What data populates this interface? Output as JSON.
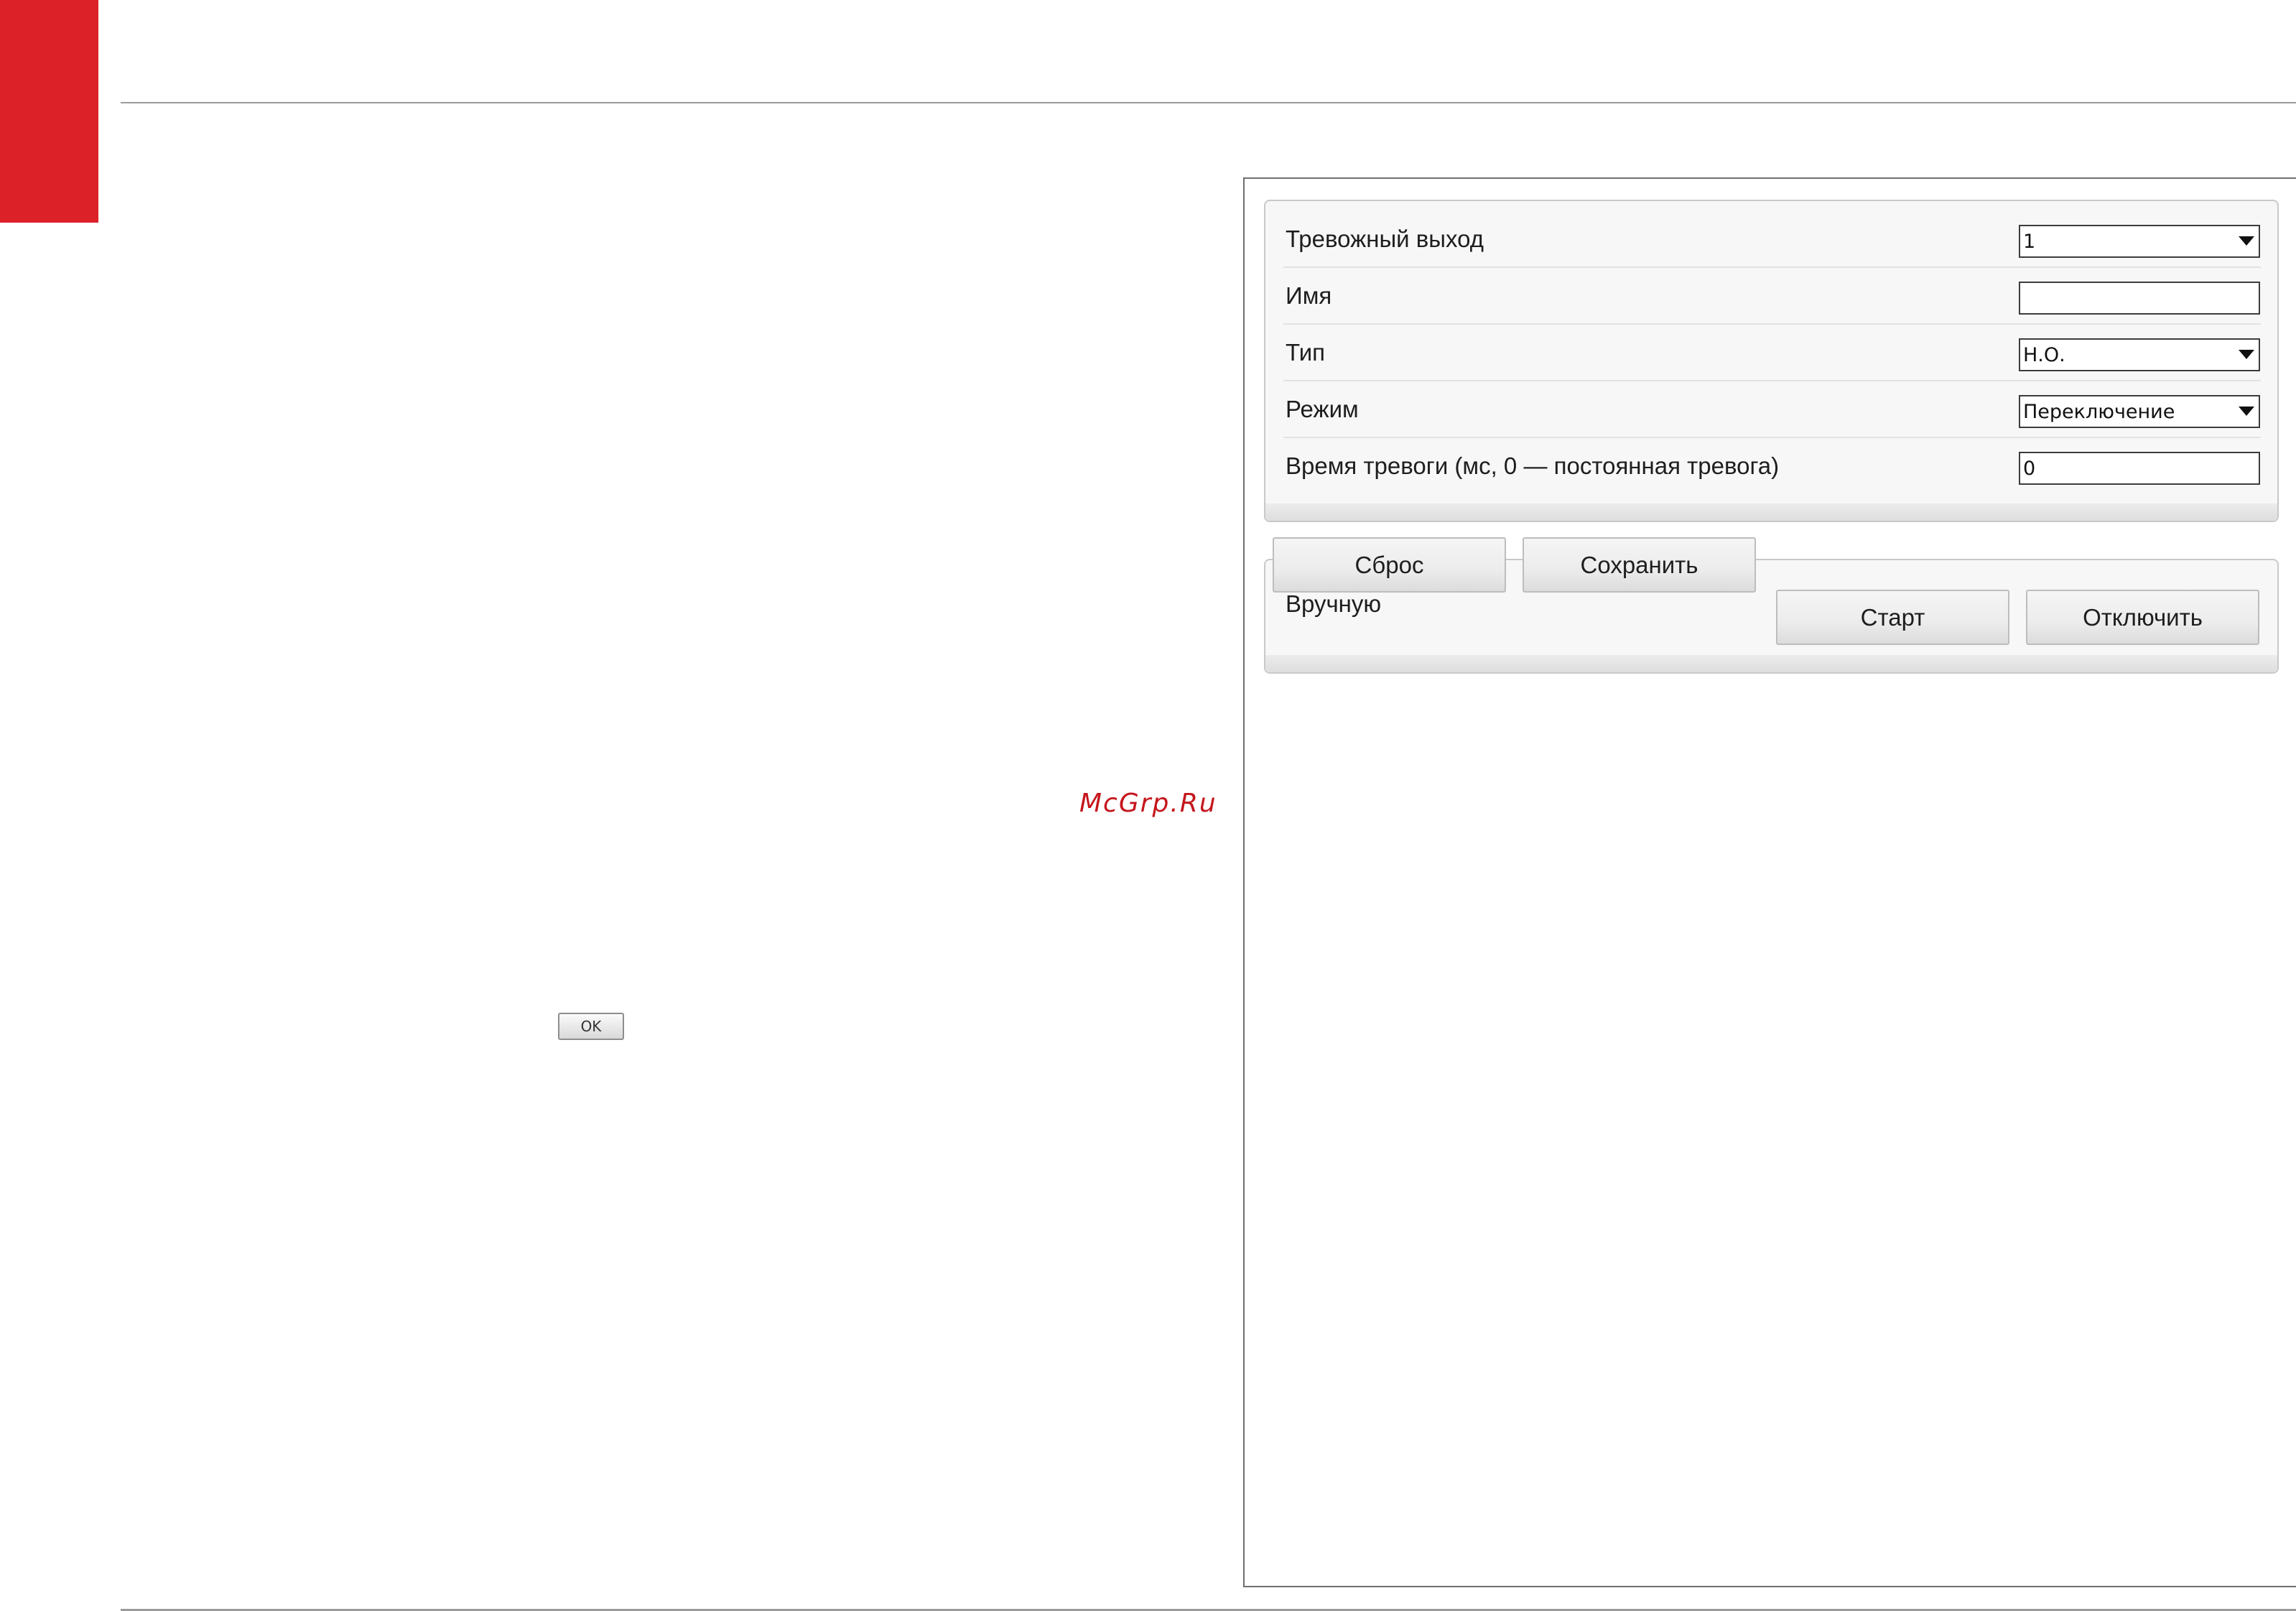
{
  "watermark": "McGrp.Ru",
  "ok_button": "OK",
  "alarm_output": {
    "rows": [
      {
        "label": "Тревожный выход",
        "kind": "select",
        "value": "1"
      },
      {
        "label": "Имя",
        "kind": "text",
        "value": ""
      },
      {
        "label": "Тип",
        "kind": "select",
        "value": "Н.О."
      },
      {
        "label": "Режим",
        "kind": "select",
        "value": "Переключение"
      },
      {
        "label": "Время тревоги (мс, 0 — постоянная тревога)",
        "kind": "text",
        "value": "0"
      }
    ]
  },
  "manual": {
    "label": "Вручную",
    "start_label": "Старт",
    "disable_label": "Отключить"
  },
  "footer": {
    "reset_label": "Сброс",
    "save_label": "Сохранить"
  },
  "colors": {
    "accent_red": "#dc2128",
    "watermark_red": "#c4161c",
    "panel_bg": "#f7f7f7",
    "panel_border": "#c9c9c9"
  },
  "icons": {
    "select_arrow": "triangle-down-icon"
  }
}
